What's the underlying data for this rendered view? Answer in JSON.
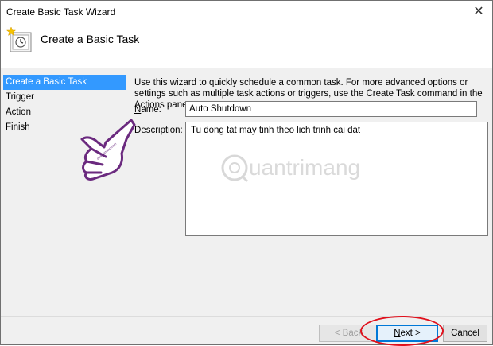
{
  "window": {
    "title": "Create Basic Task Wizard",
    "close_glyph": "✕"
  },
  "header": {
    "title": "Create a Basic Task",
    "icon": "task-scheduler-icon"
  },
  "steps": [
    "Create a Basic Task",
    "Trigger",
    "Action",
    "Finish"
  ],
  "intro": "Use this wizard to quickly schedule a common task.  For more advanced options or settings such as multiple task actions or triggers, use the Create Task command in the Actions pane.",
  "form": {
    "name_label_u": "N",
    "name_label_rest": "ame:",
    "name_value": "Auto Shutdown",
    "desc_label_u": "D",
    "desc_label_rest": "escription:",
    "desc_value": "Tu dong tat may tinh theo lich trinh cai dat"
  },
  "watermark": "uantrimang",
  "buttons": {
    "back": "< Back",
    "next": "Next >",
    "cancel": "Cancel"
  },
  "colors": {
    "accent": "#3399ff",
    "highlight_ellipse": "#e0101c",
    "hand": "#6b2a7f"
  }
}
